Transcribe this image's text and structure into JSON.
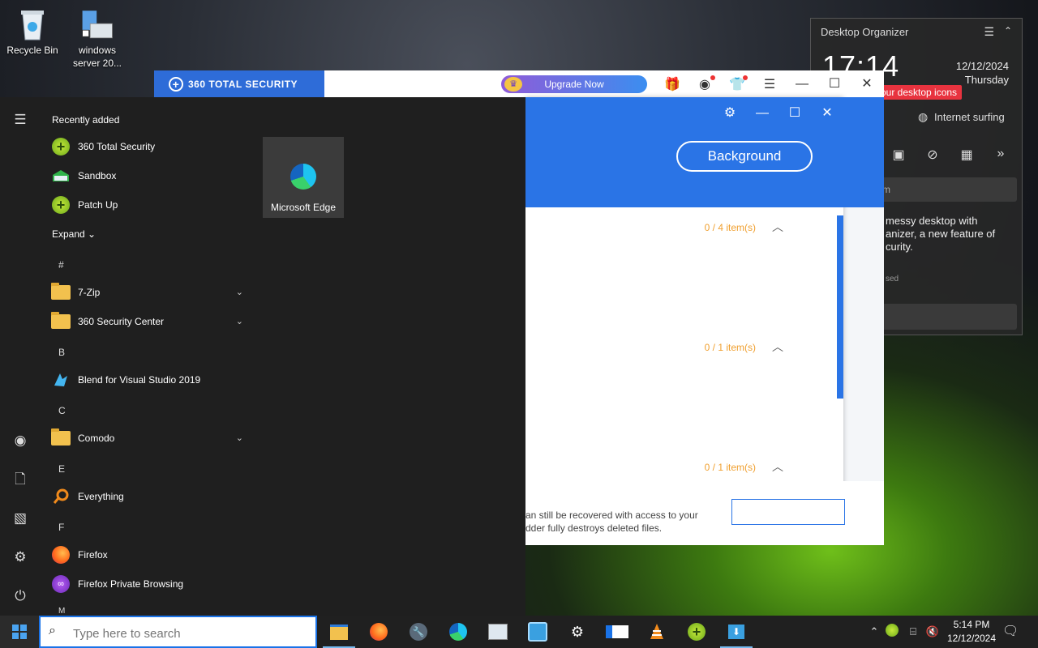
{
  "desktop": {
    "icons": [
      {
        "label": "Recycle Bin"
      },
      {
        "label": "windows server 20..."
      }
    ]
  },
  "organizer": {
    "title": "Desktop Organizer",
    "time": "17:14",
    "date": "12/12/2024",
    "weekday": "Thursday",
    "pill": "our desktop icons",
    "surf": "Internet surfing",
    "box_text": "m",
    "desc": "messy desktop with\nanizer, a new feature of\ncurity.",
    "closed": "sed"
  },
  "win360": {
    "brand": "360 TOTAL SECURITY",
    "upgrade": "Upgrade Now",
    "accent": "#2e6cd8"
  },
  "dialog": {
    "background_btn": "Background",
    "items": [
      {
        "count": "0 / 4 item(s)"
      },
      {
        "count": "0 / 1 item(s)"
      },
      {
        "count": "0 / 1 item(s)"
      }
    ],
    "bottom_text_1": "an still be recovered with access to your",
    "bottom_text_2": "dder fully destroys deleted files."
  },
  "startmenu": {
    "recently_added": "Recently added",
    "recent": [
      {
        "label": "360 Total Security"
      },
      {
        "label": "Sandbox"
      },
      {
        "label": "Patch Up"
      }
    ],
    "expand": "Expand",
    "letters": {
      "hash": "#",
      "b": "B",
      "c": "C",
      "e": "E",
      "f": "F",
      "m": "M"
    },
    "apps": {
      "zip": "7-Zip",
      "security_center": "360 Security Center",
      "blend": "Blend for Visual Studio 2019",
      "comodo": "Comodo",
      "everything": "Everything",
      "firefox": "Firefox",
      "firefox_private": "Firefox Private Browsing"
    },
    "tile_edge": "Microsoft Edge"
  },
  "taskbar": {
    "search_placeholder": "Type here to search",
    "clock_time": "5:14 PM",
    "clock_date": "12/12/2024"
  }
}
